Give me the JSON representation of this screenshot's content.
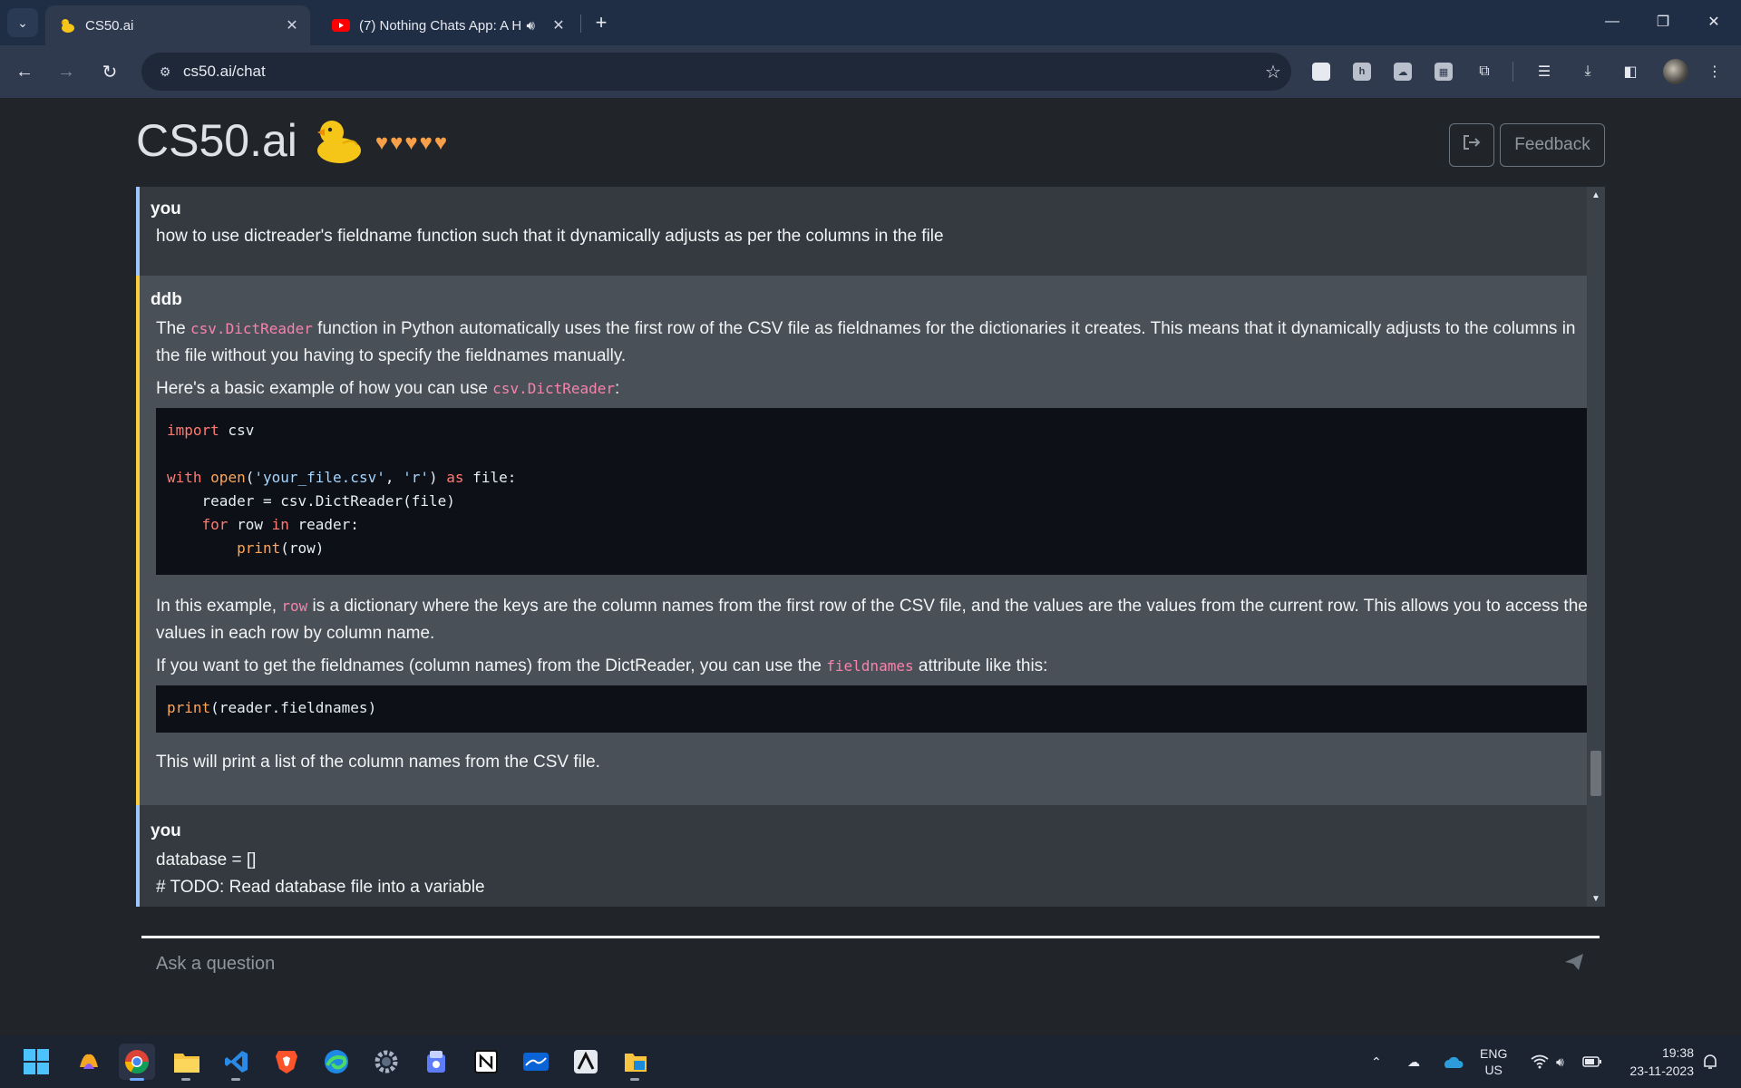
{
  "browser": {
    "tabs": [
      {
        "title": "CS50.ai",
        "active": true
      },
      {
        "title": "(7) Nothing Chats App: A H",
        "active": false
      }
    ],
    "url": "cs50.ai/chat"
  },
  "header": {
    "brand": "CS50.ai",
    "hearts": [
      "♥",
      "♥",
      "♥",
      "♥",
      "♥"
    ],
    "feedback_label": "Feedback"
  },
  "messages": {
    "m1": {
      "author": "you",
      "text": "how to use dictreader's fieldname function such that it dynamically adjusts as per the columns in the file"
    },
    "m2": {
      "author": "ddb",
      "p1_a": "The ",
      "p1_code": "csv.DictReader",
      "p1_b": " function in Python automatically uses the first row of the CSV file as fieldnames for the dictionaries it creates. This means that it dynamically adjusts to the columns in the file without you having to specify the fieldnames manually.",
      "p2_a": "Here's a basic example of how you can use ",
      "p2_code": "csv.DictReader",
      "p2_b": ":",
      "code1": {
        "l1_kw": "import",
        "l1_rest": " csv",
        "l3_kw": "with",
        "l3_fn": "open",
        "l3_a": "(",
        "l3_s1": "'your_file.csv'",
        "l3_b": ", ",
        "l3_s2": "'r'",
        "l3_c": ") ",
        "l3_kw2": "as",
        "l3_d": " file:",
        "l4": "    reader = csv.DictReader(file)",
        "l5_ind": "    ",
        "l5_kw": "for",
        "l5_a": " row ",
        "l5_kw2": "in",
        "l5_b": " reader:",
        "l6_ind": "        ",
        "l6_fn": "print",
        "l6_rest": "(row)"
      },
      "p3_a": "In this example, ",
      "p3_code": "row",
      "p3_b": " is a dictionary where the keys are the column names from the first row of the CSV file, and the values are the values from the current row. This allows you to access the values in each row by column name.",
      "p4_a": "If you want to get the fieldnames (column names) from the DictReader, you can use the ",
      "p4_code": "fieldnames",
      "p4_b": " attribute like this:",
      "code2": {
        "fn": "print",
        "rest": "(reader.fieldnames)"
      },
      "p5": "This will print a list of the column names from the CSV file."
    },
    "m3": {
      "author": "you",
      "line1": "database = []",
      "line2": "# TODO: Read database file into a variable"
    }
  },
  "composer": {
    "placeholder": "Ask a question"
  },
  "system_tray": {
    "language": "ENG",
    "region": "US",
    "time": "19:38",
    "date": "23-11-2023"
  },
  "colors": {
    "user_border": "#9ec5fe",
    "bot_border": "#ffcd39",
    "inline_code": "#f783ac",
    "hearts": "#f6a04a"
  }
}
